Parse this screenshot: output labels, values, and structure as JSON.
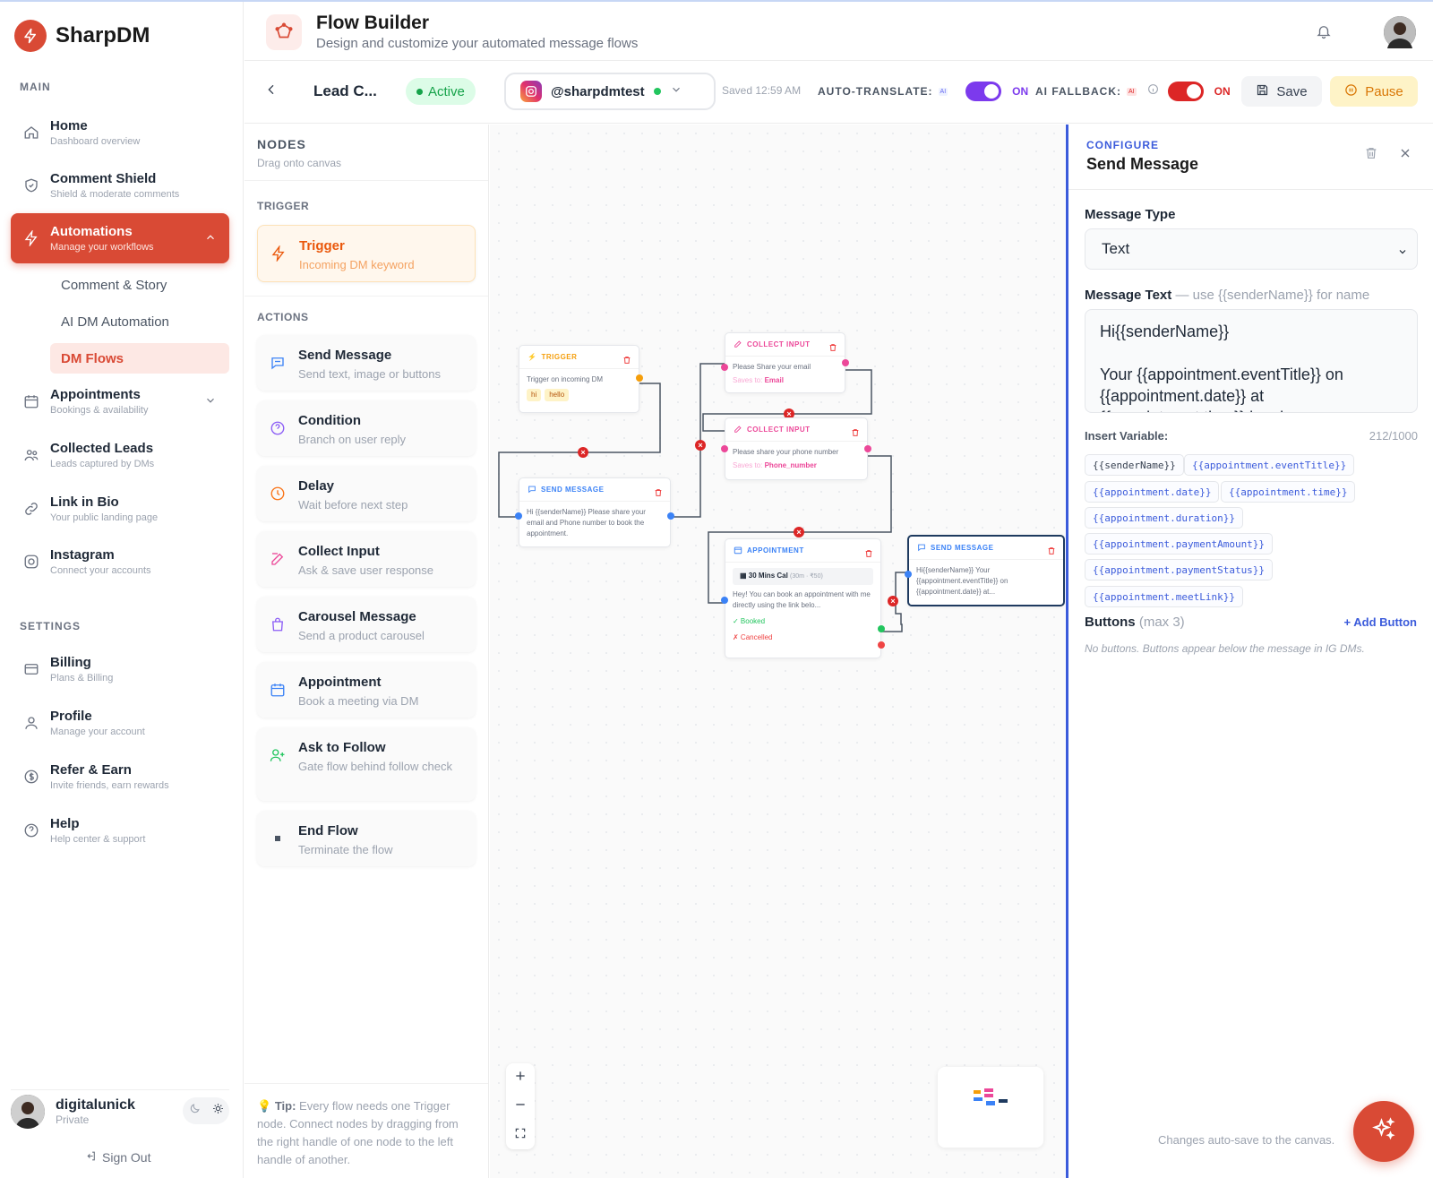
{
  "brand": {
    "name": "SharpDM"
  },
  "sidebar": {
    "main_label": "MAIN",
    "settings_label": "SETTINGS",
    "items": [
      {
        "title": "Home",
        "sub": "Dashboard overview"
      },
      {
        "title": "Comment Shield",
        "sub": "Shield & moderate comments"
      },
      {
        "title": "Automations",
        "sub": "Manage your workflows"
      },
      {
        "title": "Appointments",
        "sub": "Bookings & availability"
      },
      {
        "title": "Collected Leads",
        "sub": "Leads captured by DMs"
      },
      {
        "title": "Link in Bio",
        "sub": "Your public landing page"
      },
      {
        "title": "Instagram",
        "sub": "Connect your accounts"
      }
    ],
    "subitems": [
      "Comment & Story",
      "AI DM Automation",
      "DM Flows"
    ],
    "settings": [
      {
        "title": "Billing",
        "sub": "Plans & Billing"
      },
      {
        "title": "Profile",
        "sub": "Manage your account"
      },
      {
        "title": "Refer & Earn",
        "sub": "Invite friends, earn rewards"
      },
      {
        "title": "Help",
        "sub": "Help center & support"
      }
    ],
    "user": {
      "name": "digitalunick",
      "sub": "Private"
    },
    "signout": "Sign Out"
  },
  "header": {
    "title": "Flow Builder",
    "subtitle": "Design and customize your automated message flows"
  },
  "toolbar": {
    "flow_name": "Lead C...",
    "status": "Active",
    "account": "@sharpdmtest",
    "saved": "Saved 12:59 AM",
    "auto_translate": "AUTO-TRANSLATE:",
    "ai_fallback": "AI FALLBACK:",
    "ai_chip": "AI",
    "on": "ON",
    "save": "Save",
    "pause": "Pause",
    "colors": {
      "auto_translate": "#7c3aed",
      "ai_fallback": "#dc2626"
    }
  },
  "nodes_panel": {
    "title": "NODES",
    "subtitle": "Drag onto canvas",
    "trigger_label": "TRIGGER",
    "actions_label": "ACTIONS",
    "trigger": {
      "title": "Trigger",
      "sub": "Incoming DM keyword"
    },
    "actions": [
      {
        "title": "Send Message",
        "sub": "Send text, image or buttons"
      },
      {
        "title": "Condition",
        "sub": "Branch on user reply"
      },
      {
        "title": "Delay",
        "sub": "Wait before next step"
      },
      {
        "title": "Collect Input",
        "sub": "Ask & save user response"
      },
      {
        "title": "Carousel Message",
        "sub": "Send a product carousel"
      },
      {
        "title": "Appointment",
        "sub": "Book a meeting via DM"
      },
      {
        "title": "Ask to Follow",
        "sub": "Gate flow behind follow check"
      },
      {
        "title": "End Flow",
        "sub": "Terminate the flow"
      }
    ],
    "tip_label": "Tip:",
    "tip": "Every flow needs one Trigger node. Connect nodes by dragging from the right handle of one node to the left handle of another."
  },
  "canvas": {
    "trigger": {
      "label": "TRIGGER",
      "body": "Trigger on incoming DM",
      "kw": [
        "hi",
        "hello"
      ]
    },
    "send1": {
      "label": "SEND MESSAGE",
      "body": "Hi {{senderName}} Please share your email and Phone number to book the appointment."
    },
    "collect1": {
      "label": "COLLECT INPUT",
      "body": "Please Share your email",
      "saves_label": "Saves to:",
      "saves": "Email"
    },
    "collect2": {
      "label": "COLLECT INPUT",
      "body": "Please share your phone number",
      "saves_label": "Saves to:",
      "saves": "Phone_number"
    },
    "appt": {
      "label": "APPOINTMENT",
      "event": "30 Mins Cal",
      "meta": "(30m · ₹50)",
      "body": "Hey! You can book an appointment with me directly using the link belo...",
      "booked": "✓ Booked",
      "cancelled": "✗ Cancelled"
    },
    "send2": {
      "label": "SEND MESSAGE",
      "body": "Hi{{senderName}} Your {{appointment.eventTitle}} on {{appointment.date}} at..."
    }
  },
  "config": {
    "kicker": "CONFIGURE",
    "title": "Send Message",
    "message_type_label": "Message Type",
    "message_type": "Text",
    "message_text_label": "Message Text",
    "message_text_hint": "— use {{senderName}} for name",
    "message_text": "Hi{{senderName}}\n\nYour {{appointment.eventTitle}} on {{appointment.date}} at\n{{appointment.time}} has bee",
    "insert_label": "Insert Variable:",
    "count": "212/1000",
    "variables": [
      "{{senderName}}",
      "{{appointment.eventTitle}}",
      "{{appointment.date}}",
      "{{appointment.time}}",
      "{{appointment.duration}}",
      "{{appointment.paymentAmount}}",
      "{{appointment.paymentStatus}}",
      "{{appointment.meetLink}}"
    ],
    "buttons_label": "Buttons",
    "buttons_hint": "(max 3)",
    "add_button": "+ Add Button",
    "no_buttons": "No buttons. Buttons appear below the message in IG DMs.",
    "autosave": "Changes auto-save to the canvas."
  }
}
